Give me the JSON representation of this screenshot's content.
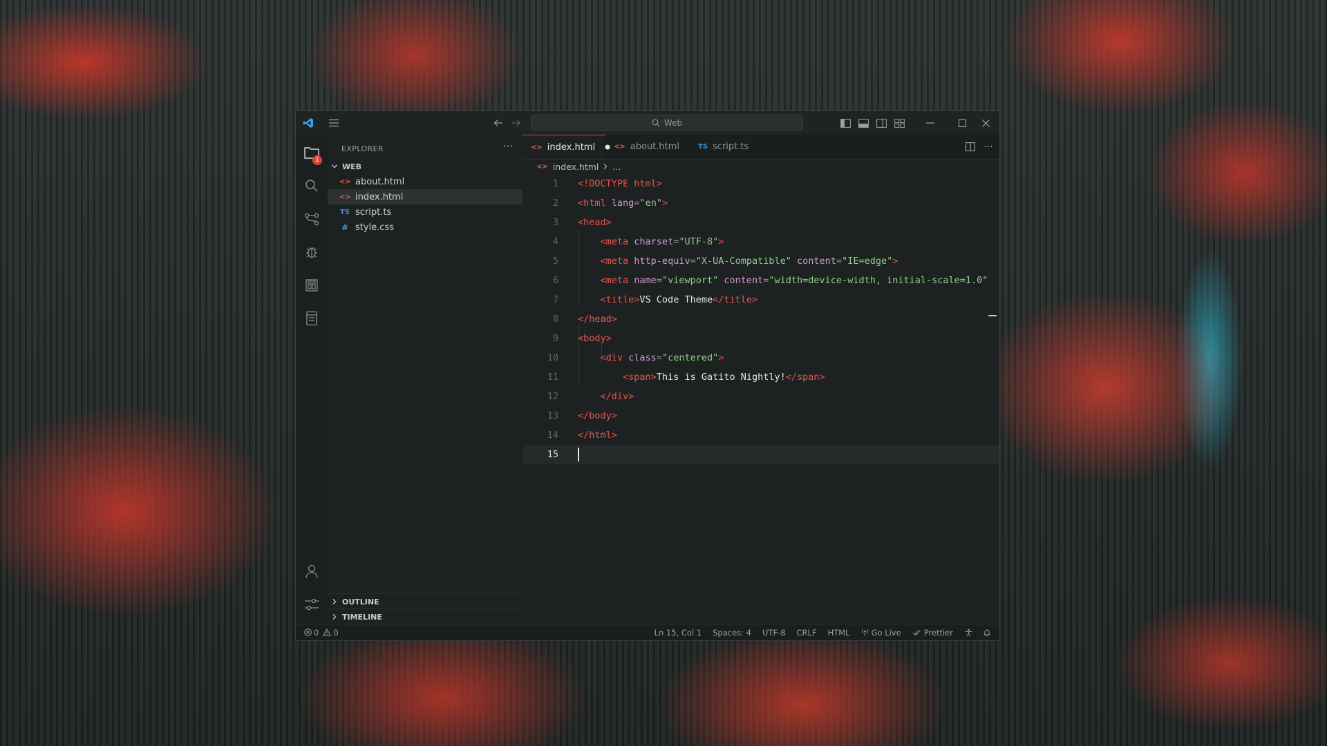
{
  "titlebar": {
    "search_text": "Web",
    "icons": [
      "vscode-logo-icon",
      "menu-icon",
      "back-arrow-icon",
      "forward-arrow-icon",
      "search-icon",
      "toggle-primary-sidebar-icon",
      "toggle-panel-icon",
      "toggle-secondary-sidebar-icon",
      "customize-layout-icon",
      "minimize-icon",
      "maximize-icon",
      "close-icon"
    ]
  },
  "activitybar": {
    "explorer_badge": "1",
    "icons": [
      "files-icon",
      "search-icon",
      "source-control-icon",
      "debug-icon",
      "extensions-icon",
      "remote-explorer-icon",
      "account-icon",
      "settings-icon"
    ]
  },
  "sidebar": {
    "title": "EXPLORER",
    "more": "···",
    "folder": "WEB",
    "files": [
      {
        "name": "about.html",
        "kind": "html"
      },
      {
        "name": "index.html",
        "kind": "html"
      },
      {
        "name": "script.ts",
        "kind": "ts"
      },
      {
        "name": "style.css",
        "kind": "css"
      }
    ],
    "ts_glyph": "TS",
    "css_glyph": "#",
    "outline": "OUTLINE",
    "timeline": "TIMELINE"
  },
  "tabs": [
    {
      "label": "index.html",
      "kind": "html",
      "active": true,
      "modified": true
    },
    {
      "label": "about.html",
      "kind": "html",
      "active": false
    },
    {
      "label": "script.ts",
      "kind": "ts",
      "active": false
    }
  ],
  "breadcrumb": {
    "file": "index.html",
    "rest": "..."
  },
  "code_lines": [
    {
      "n": "1",
      "tokens": [
        [
          "tg",
          "<!DOCTYPE html>"
        ]
      ]
    },
    {
      "n": "2",
      "tokens": [
        [
          "tg",
          "<html "
        ],
        [
          "at",
          "lang"
        ],
        [
          "pu",
          "="
        ],
        [
          "st",
          "\"en\""
        ],
        [
          "tg",
          ">"
        ]
      ]
    },
    {
      "n": "3",
      "tokens": [
        [
          "tg",
          "<head>"
        ]
      ]
    },
    {
      "n": "4",
      "tokens": [
        [
          "tx",
          "    "
        ],
        [
          "tg",
          "<meta "
        ],
        [
          "at",
          "charset"
        ],
        [
          "pu",
          "="
        ],
        [
          "st",
          "\"UTF-8\""
        ],
        [
          "tg",
          ">"
        ]
      ]
    },
    {
      "n": "5",
      "tokens": [
        [
          "tx",
          "    "
        ],
        [
          "tg",
          "<meta "
        ],
        [
          "at",
          "http-equiv"
        ],
        [
          "pu",
          "="
        ],
        [
          "st",
          "\"X-UA-Compatible\""
        ],
        [
          "at",
          " content"
        ],
        [
          "pu",
          "="
        ],
        [
          "st",
          "\"IE=edge\""
        ],
        [
          "tg",
          ">"
        ]
      ]
    },
    {
      "n": "6",
      "tokens": [
        [
          "tx",
          "    "
        ],
        [
          "tg",
          "<meta "
        ],
        [
          "at",
          "name"
        ],
        [
          "pu",
          "="
        ],
        [
          "st",
          "\"viewport\""
        ],
        [
          "at",
          " content"
        ],
        [
          "pu",
          "="
        ],
        [
          "st",
          "\"width=device-width, initial-scale=1.0\""
        ]
      ]
    },
    {
      "n": "7",
      "tokens": [
        [
          "tx",
          "    "
        ],
        [
          "tg",
          "<title>"
        ],
        [
          "tx",
          "VS Code Theme"
        ],
        [
          "tg",
          "</title>"
        ]
      ]
    },
    {
      "n": "8",
      "tokens": [
        [
          "tg",
          "</head>"
        ]
      ]
    },
    {
      "n": "9",
      "tokens": [
        [
          "tg",
          "<body>"
        ]
      ]
    },
    {
      "n": "10",
      "tokens": [
        [
          "tx",
          "    "
        ],
        [
          "tg",
          "<div "
        ],
        [
          "at",
          "class"
        ],
        [
          "pu",
          "="
        ],
        [
          "st",
          "\"centered\""
        ],
        [
          "tg",
          ">"
        ]
      ]
    },
    {
      "n": "11",
      "tokens": [
        [
          "tx",
          "        "
        ],
        [
          "tg",
          "<span>"
        ],
        [
          "tx",
          "This is Gatito Nightly!"
        ],
        [
          "tg",
          "</span>"
        ]
      ]
    },
    {
      "n": "12",
      "tokens": [
        [
          "tx",
          "    "
        ],
        [
          "tg",
          "</div>"
        ]
      ]
    },
    {
      "n": "13",
      "tokens": [
        [
          "tg",
          "</body>"
        ]
      ]
    },
    {
      "n": "14",
      "tokens": [
        [
          "tg",
          "</html>"
        ]
      ]
    },
    {
      "n": "15",
      "tokens": []
    }
  ],
  "current_line": 15,
  "statusbar": {
    "errors": "0",
    "warnings": "0",
    "position": "Ln 15, Col 1",
    "spaces": "Spaces: 4",
    "encoding": "UTF-8",
    "eol": "CRLF",
    "language": "HTML",
    "golive": "Go Live",
    "prettier": "Prettier"
  },
  "colors": {
    "accent": "#d8463a",
    "tag": "#e2574c",
    "attribute": "#d39ad0",
    "string": "#8fd08a"
  }
}
